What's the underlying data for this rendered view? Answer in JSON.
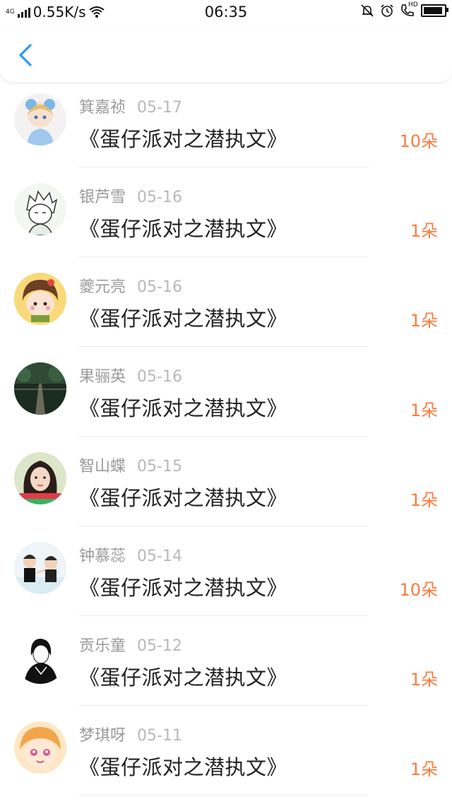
{
  "status_bar": {
    "network_label": "4G",
    "speed": "0.55K/s",
    "time": "06:35",
    "hd_label": "HD",
    "icons": [
      "signal-icon",
      "wifi-icon",
      "mute-icon",
      "alarm-icon",
      "call-hd-icon",
      "battery-icon"
    ]
  },
  "nav": {
    "back_icon": "chevron-left-icon",
    "accent_color": "#2b9af3"
  },
  "colors": {
    "count": "#ff7a3c",
    "name": "#9a9a9a",
    "title": "#222222"
  },
  "items": [
    {
      "name": "箕嘉祯",
      "date": "05-17",
      "title": "《蛋仔派对之潜执文》",
      "count": "10朵",
      "avatar": "avatar-icon"
    },
    {
      "name": "银芦雪",
      "date": "05-16",
      "title": "《蛋仔派对之潜执文》",
      "count": "1朵",
      "avatar": "avatar-icon"
    },
    {
      "name": "夔元亮",
      "date": "05-16",
      "title": "《蛋仔派对之潜执文》",
      "count": "1朵",
      "avatar": "avatar-icon"
    },
    {
      "name": "果骊英",
      "date": "05-16",
      "title": "《蛋仔派对之潜执文》",
      "count": "1朵",
      "avatar": "avatar-icon"
    },
    {
      "name": "智山蝶",
      "date": "05-15",
      "title": "《蛋仔派对之潜执文》",
      "count": "1朵",
      "avatar": "avatar-icon"
    },
    {
      "name": "钟慕蕊",
      "date": "05-14",
      "title": "《蛋仔派对之潜执文》",
      "count": "10朵",
      "avatar": "avatar-icon"
    },
    {
      "name": "贡乐童",
      "date": "05-12",
      "title": "《蛋仔派对之潜执文》",
      "count": "1朵",
      "avatar": "avatar-icon"
    },
    {
      "name": "梦琪呀",
      "date": "05-11",
      "title": "《蛋仔派对之潜执文》",
      "count": "1朵",
      "avatar": "avatar-icon"
    }
  ]
}
